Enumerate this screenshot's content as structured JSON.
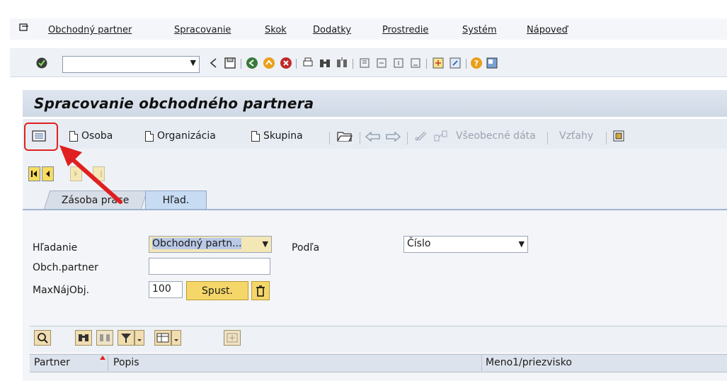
{
  "menu": {
    "items": [
      "Obchodný partner",
      "Spracovanie",
      "Skok",
      "Dodatky",
      "Prostredie",
      "Systém",
      "Nápoveď"
    ]
  },
  "title": "Spracovanie obchodného partnera",
  "app_toolbar": {
    "osoba": "Osoba",
    "organizacia": "Organizácia",
    "skupina": "Skupina",
    "vseobecne_data": "Všeobecné dáta",
    "vztahy": "Vzťahy"
  },
  "tabs": {
    "zasoba": "Zásoba práce",
    "hlad": "Hľad."
  },
  "search": {
    "hladanie_label": "Hľadanie",
    "hladanie_value": "Obchodný partn...",
    "podla_label": "Podľa",
    "podla_value": "Číslo",
    "partner_label": "Obch.partner",
    "partner_value": "",
    "max_label": "MaxNájObj.",
    "max_value": "100",
    "run_label": "Spust."
  },
  "grid": {
    "columns": [
      "Partner",
      "Popis",
      "Meno1/priezvisko"
    ]
  },
  "colors": {
    "highlight": "#e02020",
    "title_bg": "#d6dfea",
    "button_yellow": "#f5d769"
  }
}
